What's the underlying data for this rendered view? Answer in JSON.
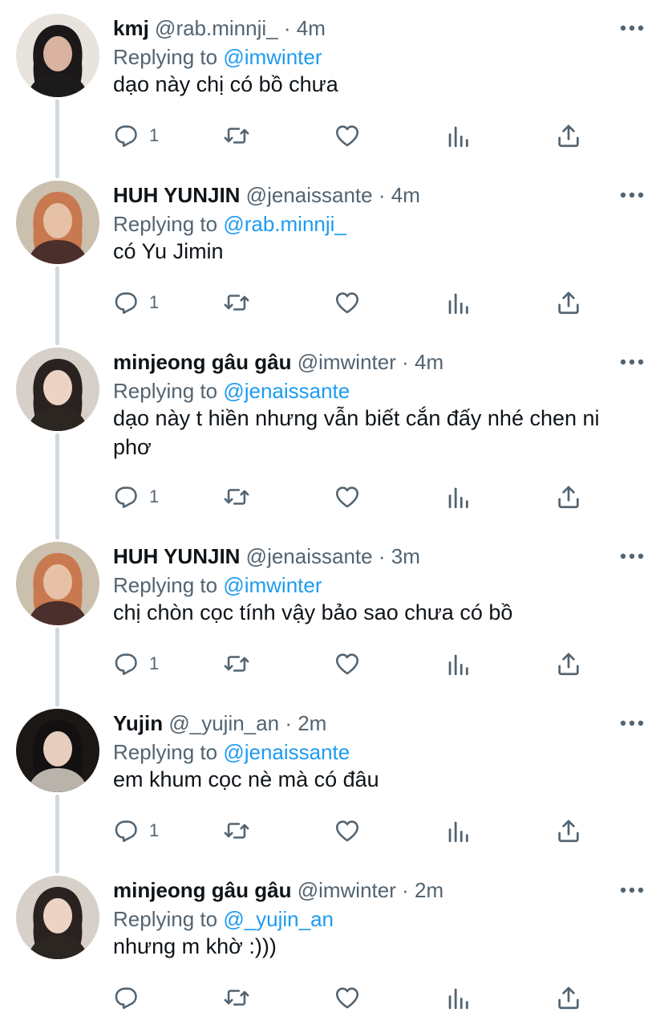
{
  "thread": {
    "reply_prefix": "Replying to",
    "dot": "·",
    "tweets": [
      {
        "name": "kmj",
        "handle": "@rab.minnji_",
        "time": "4m",
        "reply_to": "@imwinter",
        "text": "dạo này chị có bồ chưa",
        "reply_count": "1",
        "avatar_colors": {
          "bg": "#e9e3de",
          "hair": "#1c1718",
          "skin": "#d9b39f",
          "top": "#1b1b1b"
        }
      },
      {
        "name": "HUH YUNJIN",
        "handle": "@jenaissante",
        "time": "4m",
        "reply_to": "@rab.minnji_",
        "text": "có Yu Jimin",
        "reply_count": "1",
        "avatar_colors": {
          "bg": "#cbbfae",
          "hair": "#c9794f",
          "skin": "#e6c1a6",
          "top": "#4a2f2c"
        }
      },
      {
        "name": "minjeong gâu gâu",
        "handle": "@imwinter",
        "time": "4m",
        "reply_to": "@jenaissante",
        "text": "dạo này t hiền nhưng vẫn biết cắn đấy nhé chen ni phơ",
        "reply_count": "1",
        "avatar_colors": {
          "bg": "#d6d0c9",
          "hair": "#2a2220",
          "skin": "#ecd3c3",
          "top": "#2b2622"
        }
      },
      {
        "name": "HUH YUNJIN",
        "handle": "@jenaissante",
        "time": "3m",
        "reply_to": "@imwinter",
        "text": "chị chòn cọc tính vậy bảo sao chưa có bồ",
        "reply_count": "1",
        "avatar_colors": {
          "bg": "#cbbfae",
          "hair": "#c9794f",
          "skin": "#e6c1a6",
          "top": "#4a2f2c"
        }
      },
      {
        "name": "Yujin",
        "handle": "@_yujin_an",
        "time": "2m",
        "reply_to": "@jenaissante",
        "text": "em khum cọc nè mà có đâu",
        "reply_count": "1",
        "avatar_colors": {
          "bg": "#1a1715",
          "hair": "#121010",
          "skin": "#e7cdbd",
          "top": "#b9b3ab"
        }
      },
      {
        "name": "minjeong gâu gâu",
        "handle": "@imwinter",
        "time": "2m",
        "reply_to": "@_yujin_an",
        "text": "nhưng m khờ :)))",
        "reply_count": "",
        "avatar_colors": {
          "bg": "#d6d0c9",
          "hair": "#2a2220",
          "skin": "#ecd3c3",
          "top": "#2b2622"
        }
      }
    ]
  },
  "icons": {
    "more": "more-horizontal-icon",
    "reply": "reply-bubble-icon",
    "retweet": "retweet-icon",
    "like": "heart-icon",
    "analytics": "analytics-bars-icon",
    "share": "share-icon"
  },
  "colors": {
    "link_blue": "#1d9bf0",
    "secondary_text": "#536471",
    "icon_gray": "#536471",
    "thread_line": "#cfd9de"
  }
}
